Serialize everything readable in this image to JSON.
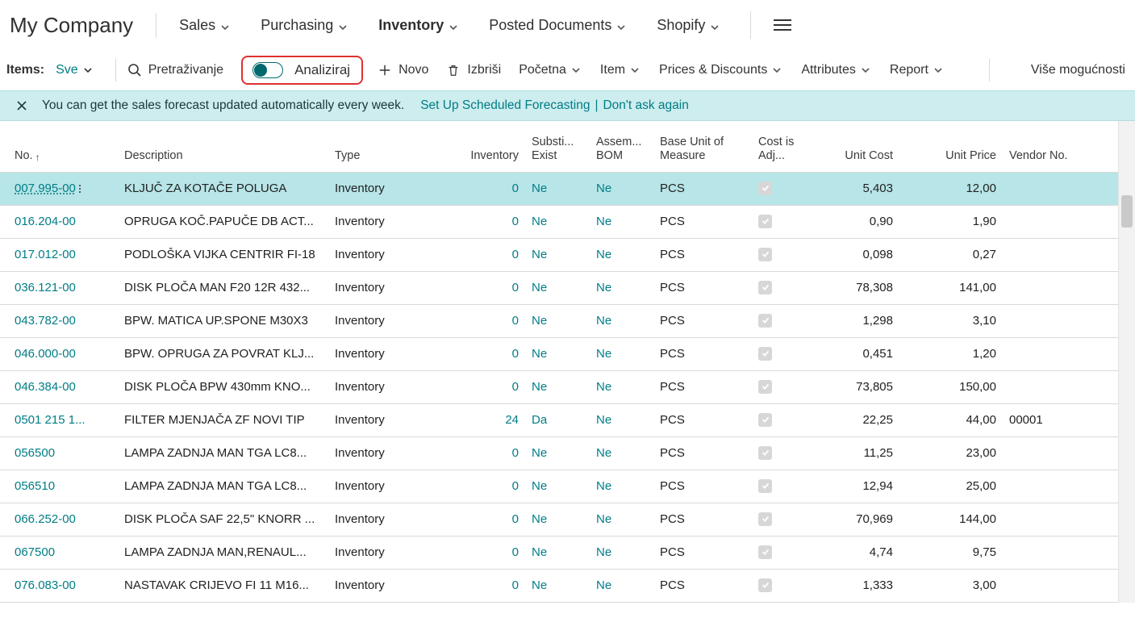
{
  "header": {
    "company": "My Company",
    "nav": [
      {
        "label": "Sales",
        "active": false
      },
      {
        "label": "Purchasing",
        "active": false
      },
      {
        "label": "Inventory",
        "active": true
      },
      {
        "label": "Posted Documents",
        "active": false
      },
      {
        "label": "Shopify",
        "active": false
      }
    ]
  },
  "actionbar": {
    "items_label": "Items:",
    "filter_value": "Sve",
    "search_label": "Pretraživanje",
    "analyze_toggle": {
      "label": "Analiziraj",
      "on": false
    },
    "new_label": "Novo",
    "delete_label": "Izbriši",
    "menus": [
      "Početna",
      "Item",
      "Prices & Discounts",
      "Attributes",
      "Report"
    ],
    "more_label": "Više mogućnosti"
  },
  "banner": {
    "text": "You can get the sales forecast updated automatically every week.",
    "link1": "Set Up Scheduled Forecasting",
    "link2": "Don't ask again"
  },
  "columns": {
    "no": "No.",
    "desc": "Description",
    "type": "Type",
    "inv": "Inventory",
    "sub": "Substi... Exist",
    "asm": "Assem... BOM",
    "uom": "Base Unit of Measure",
    "adj": "Cost is Adj...",
    "ucost": "Unit Cost",
    "uprice": "Unit Price",
    "vend": "Vendor No."
  },
  "rows": [
    {
      "no": "007.995-00",
      "desc": "KLJUČ ZA KOTAČE POLUGA",
      "type": "Inventory",
      "inv": "0",
      "sub": "Ne",
      "asm": "Ne",
      "uom": "PCS",
      "adj": true,
      "ucost": "5,403",
      "uprice": "12,00",
      "vend": "",
      "hl": true
    },
    {
      "no": "016.204-00",
      "desc": "OPRUGA KOČ.PAPUČE DB ACT...",
      "type": "Inventory",
      "inv": "0",
      "sub": "Ne",
      "asm": "Ne",
      "uom": "PCS",
      "adj": true,
      "ucost": "0,90",
      "uprice": "1,90",
      "vend": "",
      "hl": false
    },
    {
      "no": "017.012-00",
      "desc": "PODLOŠKA VIJKA CENTRIR FI-18",
      "type": "Inventory",
      "inv": "0",
      "sub": "Ne",
      "asm": "Ne",
      "uom": "PCS",
      "adj": true,
      "ucost": "0,098",
      "uprice": "0,27",
      "vend": "",
      "hl": false
    },
    {
      "no": "036.121-00",
      "desc": "DISK PLOČA MAN F20 12R 432...",
      "type": "Inventory",
      "inv": "0",
      "sub": "Ne",
      "asm": "Ne",
      "uom": "PCS",
      "adj": true,
      "ucost": "78,308",
      "uprice": "141,00",
      "vend": "",
      "hl": false
    },
    {
      "no": "043.782-00",
      "desc": "BPW. MATICA UP.SPONE M30X3",
      "type": "Inventory",
      "inv": "0",
      "sub": "Ne",
      "asm": "Ne",
      "uom": "PCS",
      "adj": true,
      "ucost": "1,298",
      "uprice": "3,10",
      "vend": "",
      "hl": false
    },
    {
      "no": "046.000-00",
      "desc": "BPW. OPRUGA ZA POVRAT KLJ...",
      "type": "Inventory",
      "inv": "0",
      "sub": "Ne",
      "asm": "Ne",
      "uom": "PCS",
      "adj": true,
      "ucost": "0,451",
      "uprice": "1,20",
      "vend": "",
      "hl": false
    },
    {
      "no": "046.384-00",
      "desc": "DISK PLOČA BPW 430mm KNO...",
      "type": "Inventory",
      "inv": "0",
      "sub": "Ne",
      "asm": "Ne",
      "uom": "PCS",
      "adj": true,
      "ucost": "73,805",
      "uprice": "150,00",
      "vend": "",
      "hl": false
    },
    {
      "no": "0501 215 1...",
      "desc": "FILTER MJENJAČA ZF NOVI TIP",
      "type": "Inventory",
      "inv": "24",
      "sub": "Da",
      "asm": "Ne",
      "uom": "PCS",
      "adj": true,
      "ucost": "22,25",
      "uprice": "44,00",
      "vend": "00001",
      "hl": false
    },
    {
      "no": "056500",
      "desc": "LAMPA ZADNJA MAN TGA LC8...",
      "type": "Inventory",
      "inv": "0",
      "sub": "Ne",
      "asm": "Ne",
      "uom": "PCS",
      "adj": true,
      "ucost": "11,25",
      "uprice": "23,00",
      "vend": "",
      "hl": false
    },
    {
      "no": "056510",
      "desc": "LAMPA ZADNJA MAN TGA LC8...",
      "type": "Inventory",
      "inv": "0",
      "sub": "Ne",
      "asm": "Ne",
      "uom": "PCS",
      "adj": true,
      "ucost": "12,94",
      "uprice": "25,00",
      "vend": "",
      "hl": false
    },
    {
      "no": "066.252-00",
      "desc": "DISK PLOČA SAF 22,5\" KNORR ...",
      "type": "Inventory",
      "inv": "0",
      "sub": "Ne",
      "asm": "Ne",
      "uom": "PCS",
      "adj": true,
      "ucost": "70,969",
      "uprice": "144,00",
      "vend": "",
      "hl": false
    },
    {
      "no": "067500",
      "desc": "LAMPA ZADNJA MAN,RENAUL...",
      "type": "Inventory",
      "inv": "0",
      "sub": "Ne",
      "asm": "Ne",
      "uom": "PCS",
      "adj": true,
      "ucost": "4,74",
      "uprice": "9,75",
      "vend": "",
      "hl": false
    },
    {
      "no": "076.083-00",
      "desc": "NASTAVAK CRIJEVO FI 11 M16...",
      "type": "Inventory",
      "inv": "0",
      "sub": "Ne",
      "asm": "Ne",
      "uom": "PCS",
      "adj": true,
      "ucost": "1,333",
      "uprice": "3,00",
      "vend": "",
      "hl": false
    }
  ]
}
